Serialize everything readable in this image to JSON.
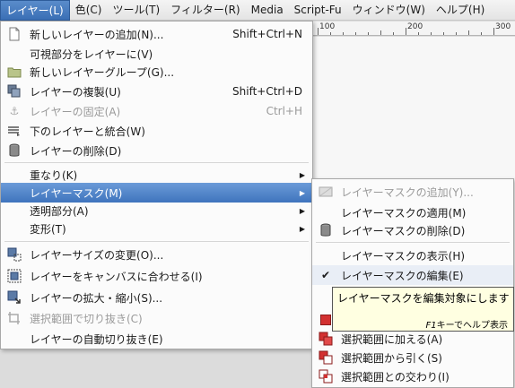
{
  "menubar": {
    "items": [
      "レイヤー(L)",
      "色(C)",
      "ツール(T)",
      "フィルター(R)",
      "Media",
      "Script-Fu",
      "ウィンドウ(W)",
      "ヘルプ(H)"
    ]
  },
  "ruler": {
    "labels": [
      "100",
      "200",
      "300"
    ]
  },
  "layer_menu": {
    "items": [
      {
        "label": "新しいレイヤーの追加(N)...",
        "accel": "Shift+Ctrl+N",
        "icon": "new-layer-icon",
        "disabled": false
      },
      {
        "label": "可視部分をレイヤーに(V)",
        "accel": "",
        "icon": "",
        "disabled": false
      },
      {
        "label": "新しいレイヤーグループ(G)...",
        "accel": "",
        "icon": "folder-icon",
        "disabled": false
      },
      {
        "label": "レイヤーの複製(U)",
        "accel": "Shift+Ctrl+D",
        "icon": "duplicate-icon",
        "disabled": false
      },
      {
        "label": "レイヤーの固定(A)",
        "accel": "Ctrl+H",
        "icon": "anchor-icon",
        "disabled": true
      },
      {
        "label": "下のレイヤーと統合(W)",
        "accel": "",
        "icon": "merge-down-icon",
        "disabled": false
      },
      {
        "label": "レイヤーの削除(D)",
        "accel": "",
        "icon": "trash-icon",
        "disabled": false
      },
      {
        "label": "重なり(K)",
        "accel": "",
        "icon": "",
        "disabled": false,
        "submenu": true
      },
      {
        "label": "レイヤーマスク(M)",
        "accel": "",
        "icon": "",
        "disabled": false,
        "submenu": true,
        "highlighted": true
      },
      {
        "label": "透明部分(A)",
        "accel": "",
        "icon": "",
        "disabled": false,
        "submenu": true
      },
      {
        "label": "変形(T)",
        "accel": "",
        "icon": "",
        "disabled": false,
        "submenu": true
      },
      {
        "label": "レイヤーサイズの変更(O)...",
        "accel": "",
        "icon": "resize-icon",
        "disabled": false
      },
      {
        "label": "レイヤーをキャンバスに合わせる(I)",
        "accel": "",
        "icon": "fit-canvas-icon",
        "disabled": false
      },
      {
        "label": "レイヤーの拡大・縮小(S)...",
        "accel": "",
        "icon": "scale-icon",
        "disabled": false
      },
      {
        "label": "選択範囲で切り抜き(C)",
        "accel": "",
        "icon": "crop-icon",
        "disabled": true
      },
      {
        "label": "レイヤーの自動切り抜き(E)",
        "accel": "",
        "icon": "",
        "disabled": false
      }
    ]
  },
  "mask_menu": {
    "items": [
      {
        "label": "レイヤーマスクの追加(Y)...",
        "icon": "add-mask-icon",
        "disabled": true
      },
      {
        "label": "レイヤーマスクの適用(M)",
        "icon": "",
        "disabled": false
      },
      {
        "label": "レイヤーマスクの削除(D)",
        "icon": "trash-icon",
        "disabled": false
      },
      {
        "label": "レイヤーマスクの表示(H)",
        "icon": "",
        "disabled": false
      },
      {
        "label": "レイヤーマスクの編集(E)",
        "icon": "check-icon",
        "disabled": false,
        "checked": true
      },
      {
        "label": "選択範囲に加える(A)",
        "icon": "selection-add-icon",
        "disabled": false
      },
      {
        "label": "選択範囲から引く(S)",
        "icon": "selection-subtract-icon",
        "disabled": false
      },
      {
        "label": "選択範囲との交わり(I)",
        "icon": "selection-intersect-icon",
        "disabled": false
      }
    ]
  },
  "tooltip": {
    "text": "レイヤーマスクを編集対象にします",
    "key": "F1",
    "help": "キーでヘルプ表示"
  },
  "colors": {
    "highlight": "#3f74bd",
    "disabled_text": "#9a9a9a",
    "tooltip_bg": "#ffffe1",
    "mask_red": "#d23030"
  }
}
